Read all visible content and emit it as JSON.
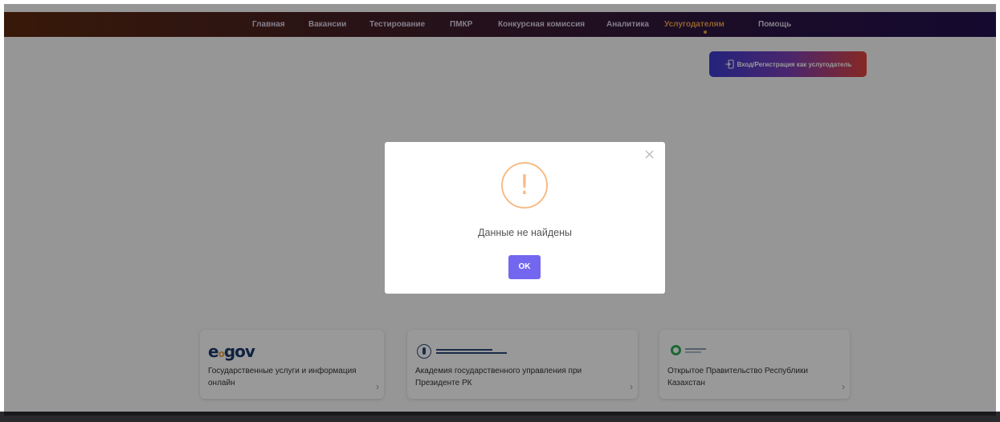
{
  "nav": {
    "items": [
      {
        "label": "Главная"
      },
      {
        "label": "Вакансии"
      },
      {
        "label": "Тестирование"
      },
      {
        "label": "ПМКР"
      },
      {
        "label": "Конкурсная комиссия"
      },
      {
        "label": "Аналитика"
      },
      {
        "label": "Услугодателям"
      },
      {
        "label": "Помощь"
      }
    ],
    "active": "Услугодателям"
  },
  "login_button": {
    "label": "Вход/Регистрация как услугодатель",
    "icon": "login-icon"
  },
  "cards": [
    {
      "logo": "e-gov-logo",
      "logo_text": "e gov",
      "text": "Государственные услуги и информация онлайн",
      "icon": "chevron-right-icon"
    },
    {
      "logo": "academy-logo",
      "text": "Академия государственного управления при Президенте РК",
      "icon": "chevron-right-icon"
    },
    {
      "logo": "open-government-logo",
      "text": "Открытое Правительство Республики Казахстан",
      "icon": "chevron-right-icon"
    }
  ],
  "modal": {
    "icon": "warning-icon",
    "icon_glyph": "!",
    "message": "Данные не найдены",
    "ok_label": "OK",
    "close_icon": "close-icon",
    "close_glyph": "×"
  },
  "colors": {
    "accent": "#7367f0",
    "warning": "#f8bb86",
    "nav_active": "#f0a347",
    "nav_bg_start": "#5e2a0f",
    "nav_bg_end": "#22104e"
  }
}
